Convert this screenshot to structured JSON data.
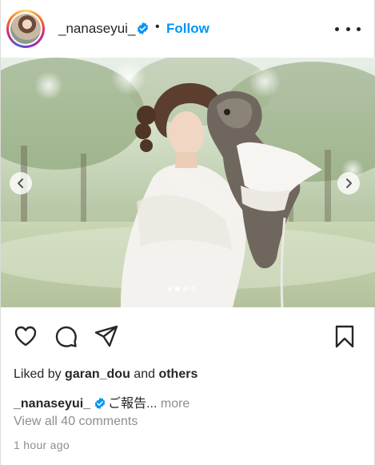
{
  "header": {
    "username": "_nanaseyui_",
    "separator": "•",
    "follow_label": "Follow",
    "verified_icon": "verified-badge-icon",
    "options_icon": "more-options-icon"
  },
  "media": {
    "description_icon": "photo-woman-kissing-dog",
    "prev_icon": "chevron-left-icon",
    "next_icon": "chevron-right-icon",
    "carousel_count": 4,
    "carousel_active_index": 1
  },
  "actions": {
    "like_icon": "heart-icon",
    "comment_icon": "comment-icon",
    "share_icon": "share-icon",
    "save_icon": "bookmark-icon"
  },
  "likes": {
    "prefix": "Liked by ",
    "user": "garan_dou",
    "connector": " and ",
    "others": "others"
  },
  "caption": {
    "username": "_nanaseyui_",
    "text": "ご報告...",
    "more_label": "more"
  },
  "comments": {
    "view_all_label": "View all 40 comments"
  },
  "timestamp": "1 hour ago",
  "colors": {
    "link_blue": "#0095f6",
    "text": "#262626",
    "secondary_text": "#8e8e8e",
    "verified_blue": "#0095f6"
  }
}
